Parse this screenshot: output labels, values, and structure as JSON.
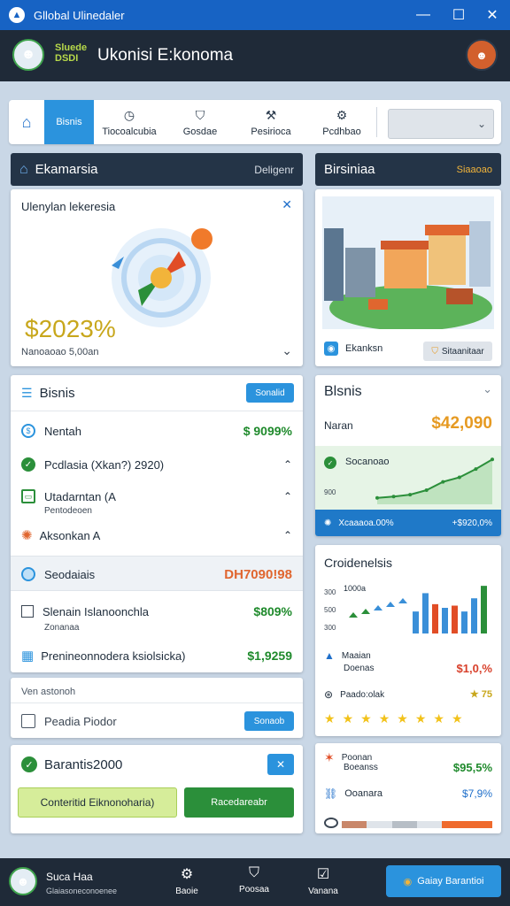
{
  "window": {
    "title": "Gllobal Ulinedaler",
    "minimize": "—",
    "maximize": "☐",
    "close": "✕"
  },
  "header": {
    "brand_line1": "Sluede",
    "brand_line2": "DSDI",
    "app_title": "Ukonisi E:konoma"
  },
  "tabs": [
    {
      "label": "Bisnis",
      "icon": "home-icon"
    },
    {
      "label": "Tiocoalcubia"
    },
    {
      "label": "Gosdae"
    },
    {
      "label": "Pesirioca"
    },
    {
      "label": "Pcdhbao"
    }
  ],
  "tabs_select": {
    "value": ""
  },
  "left_bar": {
    "title": "Ekamarsia",
    "action": "Deligenr"
  },
  "right_bar": {
    "title": "Birsiniaa",
    "action": "Siaaoao"
  },
  "economy_card": {
    "title": "Ulenylan lekeresia",
    "value": "$2023%",
    "caption": "Nanoaoao  5,00an"
  },
  "property_card": {
    "button1": "Ekanksn",
    "button2": "Sitaanitaar"
  },
  "bisnis_list": {
    "title": "Bisnis",
    "button": "Sonalid",
    "items": [
      {
        "label": "Nentah",
        "value": "$ 9099%"
      },
      {
        "label": "Pcdlasia (Xkan?) 2920)",
        "value": ""
      },
      {
        "label": "Utadarntan (A",
        "sub": "Pentodeoen",
        "value": ""
      },
      {
        "label": "Aksonkan A",
        "value": ""
      },
      {
        "label": "Seodaiais",
        "value": "DH7090!98"
      },
      {
        "label": "Slenain Islanoonchla",
        "sub": "Zonanaa",
        "value": "$809%"
      },
      {
        "label": "Prenineonnodera ksiolsicka)",
        "value": "$1,9259"
      }
    ]
  },
  "bisnis_stats": {
    "title": "Blsnis",
    "label": "Naran",
    "value": "$42,090",
    "chart_label": "Socanoao",
    "chart_axis": "900",
    "footer_left": "Xcaaaoa.00%",
    "footer_right": "+$920,0%"
  },
  "chart_data": {
    "type": "line",
    "title": "",
    "x": [
      0,
      1,
      2,
      3,
      4,
      5,
      6,
      7
    ],
    "y": [
      10,
      12,
      15,
      22,
      35,
      42,
      55,
      70
    ],
    "ylim": [
      0,
      80
    ]
  },
  "credits_card": {
    "title": "Croidenelsis",
    "chart_legend": "1000a",
    "axis_labels": [
      "300",
      "500",
      "300"
    ],
    "chart": {
      "type": "bar",
      "values": [
        30,
        55,
        40,
        35,
        38,
        30,
        48,
        65
      ]
    },
    "rows": [
      {
        "label": "Maaian",
        "sub": "Doenas",
        "value": "$1,0,%"
      },
      {
        "label": "Paado:olak",
        "value": "★ 75"
      }
    ],
    "stars": 8
  },
  "bottom_right": {
    "row1_label": "Poonan",
    "row1_sub": "Boeanss",
    "row1_value": "$95,5%",
    "row2_label": "Ooanara",
    "row2_value": "$7,9%"
  },
  "ventures": {
    "heading": "Ven astonoh",
    "item": "Peadia Piodor",
    "button": "Sonaob"
  },
  "bars_card": {
    "title": "Barantis2000",
    "button1": "Conteritid Eiknonoharia)",
    "button2": "Racedareabr"
  },
  "footer": {
    "name": "Suca Haa",
    "sub": "Glaiasoneconoenee",
    "nav": [
      {
        "label": "Baoie",
        "icon": "gear-icon"
      },
      {
        "label": "Poosaa",
        "icon": "user-icon"
      },
      {
        "label": "Vanana",
        "icon": "check-icon"
      }
    ],
    "cta": "Gaiay Barantioi"
  }
}
